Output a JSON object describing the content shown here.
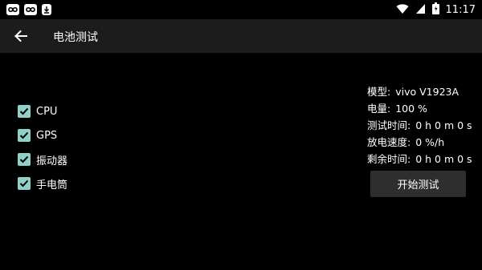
{
  "status_bar": {
    "time": "11:17",
    "left_icons": [
      "app-notification-icon",
      "app-notification-icon",
      "download-notification-icon"
    ],
    "right_icons": [
      "wifi-icon",
      "cellular-signal-icon",
      "battery-icon"
    ]
  },
  "toolbar": {
    "title": "电池测试",
    "back_icon": "arrow-left-icon"
  },
  "options": [
    {
      "label": "CPU",
      "checked": true
    },
    {
      "label": "GPS",
      "checked": true
    },
    {
      "label": "振动器",
      "checked": true
    },
    {
      "label": "手电筒",
      "checked": true
    }
  ],
  "info": {
    "model_label": "模型:",
    "model_value": "vivo V1923A",
    "battery_label": "电量:",
    "battery_value": "100 %",
    "test_time_label": "测试时间:",
    "test_time_value": "0 h 0 m 0 s",
    "discharge_label": "放电速度:",
    "discharge_value": "0 %/h",
    "remaining_label": "剩余时间:",
    "remaining_value": "0 h 0 m 0 s"
  },
  "start_button_label": "开始测试",
  "colors": {
    "background": "#000000",
    "toolbar": "#1c1c1c",
    "checkbox": "#8fd0c8",
    "button": "#2e2e2e"
  }
}
